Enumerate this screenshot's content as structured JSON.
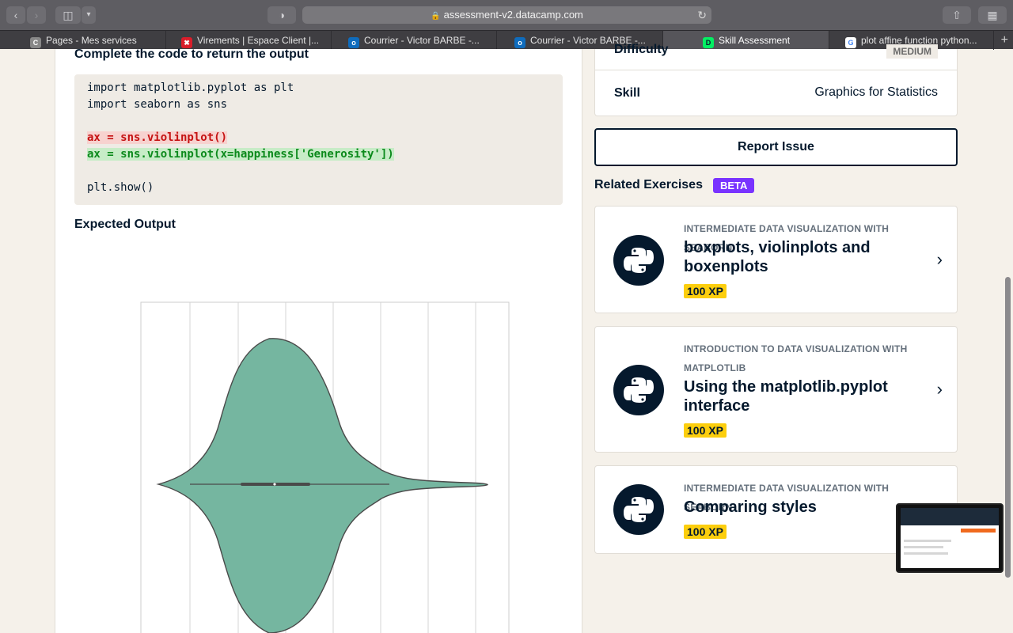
{
  "browser": {
    "url": "assessment-v2.datacamp.com",
    "tabs": [
      {
        "label": "Pages - Mes services",
        "favicon": "C",
        "color": "#888888"
      },
      {
        "label": "Virements | Espace Client |...",
        "favicon": "✖",
        "color": "#d91d2a"
      },
      {
        "label": "Courrier - Victor BARBE -...",
        "favicon": "o",
        "color": "#0f6cbd"
      },
      {
        "label": "Courrier - Victor BARBE -...",
        "favicon": "o",
        "color": "#0f6cbd"
      },
      {
        "label": "Skill Assessment",
        "favicon": "D",
        "color": "#03ef62"
      },
      {
        "label": "plot affine function python...",
        "favicon": "G",
        "color": "#ffffff"
      }
    ]
  },
  "exercise": {
    "heading": "Complete the code to return the output",
    "code": [
      {
        "text": "import matplotlib.pyplot as plt",
        "kind": "normal"
      },
      {
        "text": "import seaborn as sns",
        "kind": "normal"
      },
      {
        "text": "",
        "kind": "normal"
      },
      {
        "text": "ax = sns.violinplot()",
        "kind": "removed"
      },
      {
        "text": "ax = sns.violinplot(x=happiness['Generosity'])",
        "kind": "added"
      },
      {
        "text": "",
        "kind": "normal"
      },
      {
        "text": "plt.show()",
        "kind": "normal"
      }
    ],
    "expected_label": "Expected Output"
  },
  "chart_data": {
    "type": "violin",
    "fill_color": "#75b6a0",
    "edge_color": "#4a4a4a",
    "grid": true
  },
  "details": {
    "difficulty_label": "Difficulty",
    "difficulty_value": "MEDIUM",
    "skill_label": "Skill",
    "skill_value": "Graphics for Statistics"
  },
  "report_label": "Report Issue",
  "related": {
    "title": "Related Exercises",
    "badge": "BETA",
    "items": [
      {
        "course": "INTERMEDIATE DATA VISUALIZATION WITH SEABORN",
        "title": "boxplots, violinplots and boxenplots",
        "xp": "100 XP",
        "icon": "python-icon",
        "has_chevron": true
      },
      {
        "course": "INTRODUCTION TO DATA VISUALIZATION WITH MATPLOTLIB",
        "title": "Using the matplotlib.pyplot interface",
        "xp": "100 XP",
        "icon": "python-icon",
        "has_chevron": true
      },
      {
        "course": "INTERMEDIATE DATA VISUALIZATION WITH SEABORN",
        "title": "Comparing styles",
        "xp": "100 XP",
        "icon": "python-icon",
        "has_chevron": false
      }
    ]
  }
}
